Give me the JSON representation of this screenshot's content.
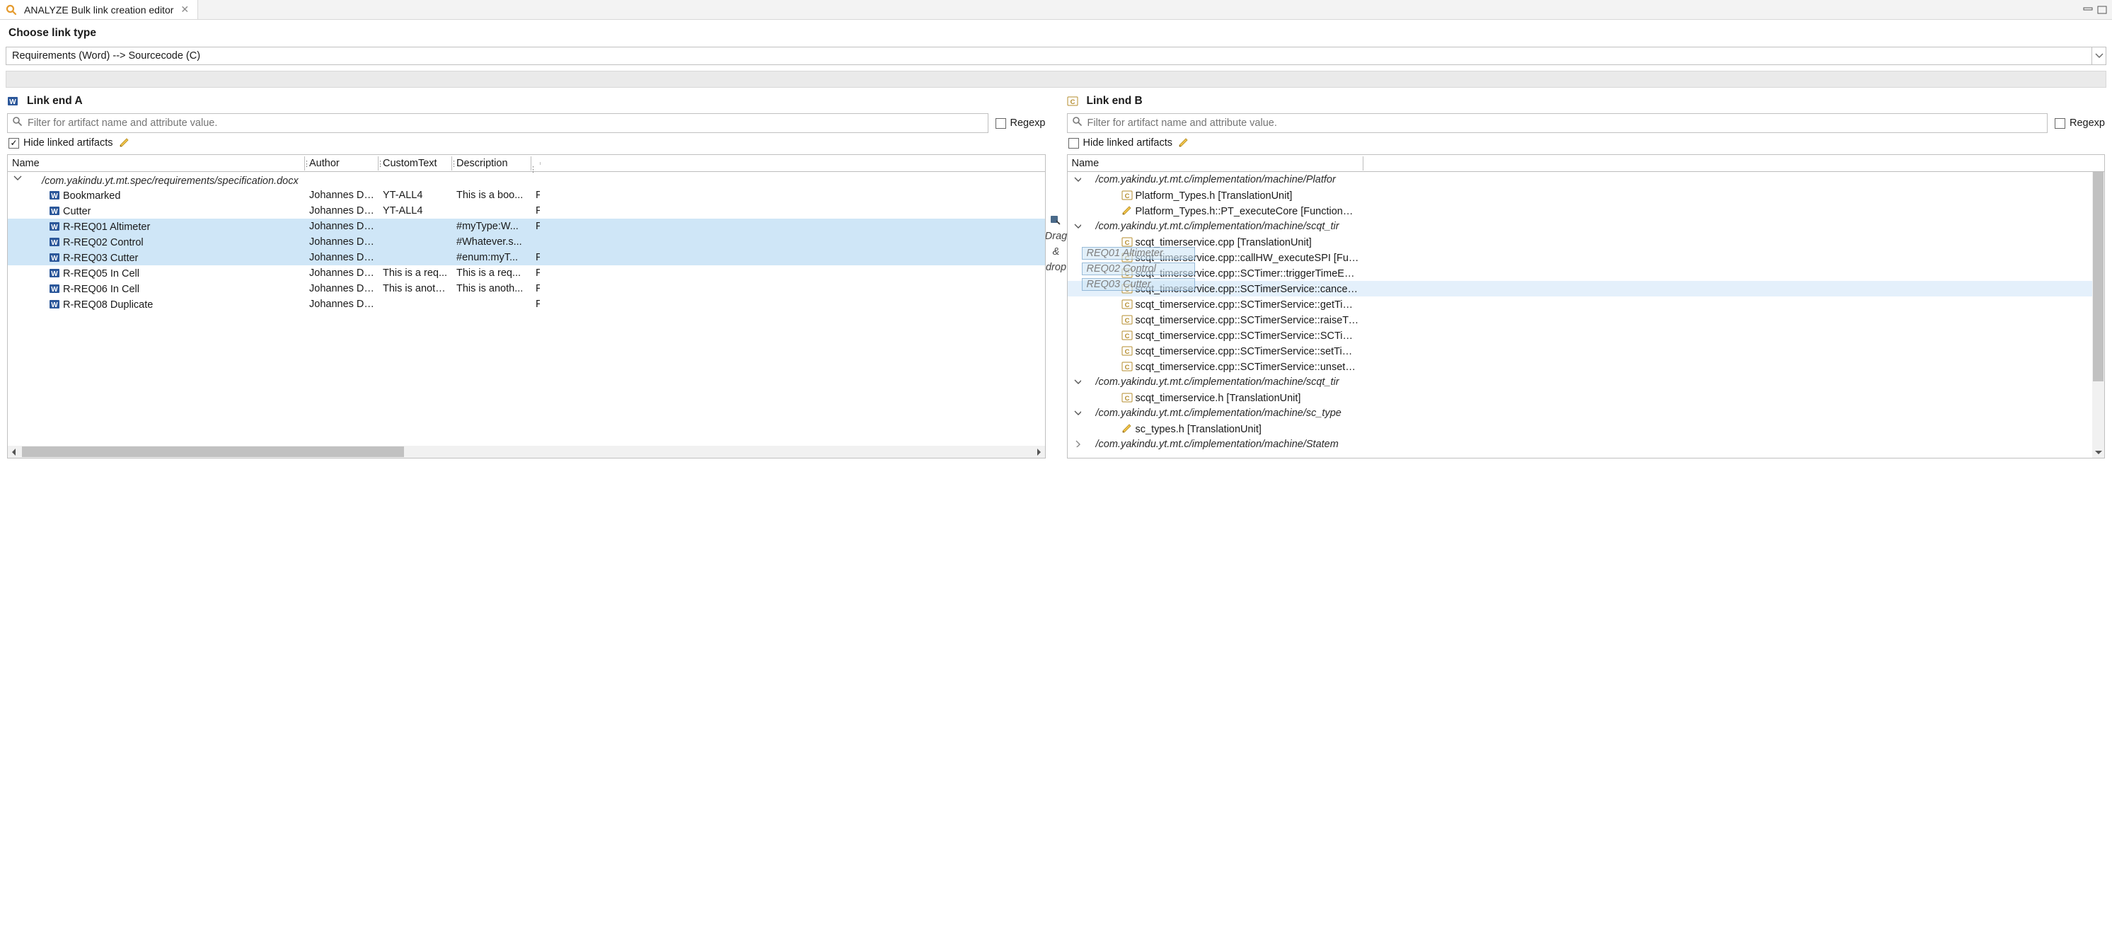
{
  "tab": {
    "title": "ANALYZE Bulk link creation editor"
  },
  "choose": {
    "title": "Choose link type",
    "value": "Requirements (Word) --> Sourcecode (C)"
  },
  "panes": {
    "a": {
      "title": "Link end A",
      "filter_placeholder": "Filter for artifact name and attribute value.",
      "regexp_label": "Regexp",
      "hide_linked_label": "Hide linked artifacts",
      "columns": {
        "name": "Name",
        "author": "Author",
        "custom": "CustomText",
        "desc": "Description"
      },
      "root_path": "/com.yakindu.yt.mt.spec/requirements/specification.docx",
      "rows": [
        {
          "name": "Bookmarked",
          "author": "Johannes Di...",
          "custom": "YT-ALL4",
          "desc": "This is a boo...",
          "rest": "F",
          "icon": "word",
          "sel": false
        },
        {
          "name": "Cutter",
          "author": "Johannes Di...",
          "custom": "YT-ALL4",
          "desc": "",
          "rest": "F",
          "icon": "word",
          "sel": false
        },
        {
          "name": "R-REQ01 Altimeter",
          "author": "Johannes Di...",
          "custom": "",
          "desc": "#myType:W...",
          "rest": "F",
          "icon": "word",
          "sel": true
        },
        {
          "name": "R-REQ02 Control",
          "author": "Johannes Di...",
          "custom": "",
          "desc": "#Whatever.s...",
          "rest": "",
          "icon": "word",
          "sel": true
        },
        {
          "name": "R-REQ03 Cutter",
          "author": "Johannes Di...",
          "custom": "",
          "desc": "#enum:myT...",
          "rest": "F",
          "icon": "word",
          "sel": true
        },
        {
          "name": "R-REQ05 In Cell",
          "author": "Johannes Di...",
          "custom": "This is a req...",
          "desc": "This is a req...",
          "rest": "F",
          "icon": "word",
          "sel": false
        },
        {
          "name": "R-REQ06 In Cell",
          "author": "Johannes Di...",
          "custom": "This is anoth...",
          "desc": "This is anoth...",
          "rest": "F",
          "icon": "word",
          "sel": false
        },
        {
          "name": "R-REQ08 Duplicate",
          "author": "Johannes Di...",
          "custom": "",
          "desc": "",
          "rest": "F",
          "icon": "word",
          "sel": false
        }
      ]
    },
    "b": {
      "title": "Link end B",
      "filter_placeholder": "Filter for artifact name and attribute value.",
      "regexp_label": "Regexp",
      "hide_linked_label": "Hide linked artifacts",
      "columns": {
        "name": "Name"
      },
      "nodes": [
        {
          "exp": "down",
          "depth": 0,
          "italic": true,
          "icon": "",
          "label": "/com.yakindu.yt.mt.c/implementation/machine/Platfor"
        },
        {
          "exp": "",
          "depth": 1,
          "italic": false,
          "icon": "c",
          "label": "Platform_Types.h [TranslationUnit]"
        },
        {
          "exp": "",
          "depth": 1,
          "italic": false,
          "icon": "pencil",
          "label": "Platform_Types.h::PT_executeCore [FunctionDeclara"
        },
        {
          "exp": "down",
          "depth": 0,
          "italic": true,
          "icon": "",
          "label": "/com.yakindu.yt.mt.c/implementation/machine/scqt_tir"
        },
        {
          "exp": "",
          "depth": 1,
          "italic": false,
          "icon": "c",
          "label": "scqt_timerservice.cpp [TranslationUnit]"
        },
        {
          "exp": "",
          "depth": 1,
          "italic": false,
          "icon": "c",
          "label": "scqt_timerservice.cpp::callHW_executeSPI [Function"
        },
        {
          "exp": "",
          "depth": 1,
          "italic": false,
          "icon": "c",
          "label": "scqt_timerservice.cpp::SCTimer::triggerTimeEvent [F"
        },
        {
          "exp": "",
          "depth": 1,
          "italic": false,
          "icon": "c",
          "label": "scqt_timerservice.cpp::SCTimerService::cancel [Func",
          "hov": true
        },
        {
          "exp": "",
          "depth": 1,
          "italic": false,
          "icon": "c",
          "label": "scqt_timerservice.cpp::SCTimerService::getTimer [Fu"
        },
        {
          "exp": "",
          "depth": 1,
          "italic": false,
          "icon": "c",
          "label": "scqt_timerservice.cpp::SCTimerService::raiseTimeEve"
        },
        {
          "exp": "",
          "depth": 1,
          "italic": false,
          "icon": "c",
          "label": "scqt_timerservice.cpp::SCTimerService::SCTimerServ"
        },
        {
          "exp": "",
          "depth": 1,
          "italic": false,
          "icon": "c",
          "label": "scqt_timerservice.cpp::SCTimerService::setTimer [Fu"
        },
        {
          "exp": "",
          "depth": 1,
          "italic": false,
          "icon": "c",
          "label": "scqt_timerservice.cpp::SCTimerService::unsetTimer ["
        },
        {
          "exp": "down",
          "depth": 0,
          "italic": true,
          "icon": "",
          "label": "/com.yakindu.yt.mt.c/implementation/machine/scqt_tir"
        },
        {
          "exp": "",
          "depth": 1,
          "italic": false,
          "icon": "c",
          "label": "scqt_timerservice.h [TranslationUnit]"
        },
        {
          "exp": "down",
          "depth": 0,
          "italic": true,
          "icon": "",
          "label": "/com.yakindu.yt.mt.c/implementation/machine/sc_type"
        },
        {
          "exp": "",
          "depth": 1,
          "italic": false,
          "icon": "pencil",
          "label": "sc_types.h [TranslationUnit]"
        },
        {
          "exp": "right",
          "depth": 0,
          "italic": true,
          "icon": "",
          "label": "/com.yakindu.yt.mt.c/implementation/machine/Statem"
        }
      ],
      "ghosts": [
        "REQ01 Altimeter",
        "REQ02 Control",
        "REQ03 Cutter"
      ]
    }
  },
  "dragdrop": {
    "line1": "Drag",
    "amp": "&",
    "line3": "drop"
  }
}
